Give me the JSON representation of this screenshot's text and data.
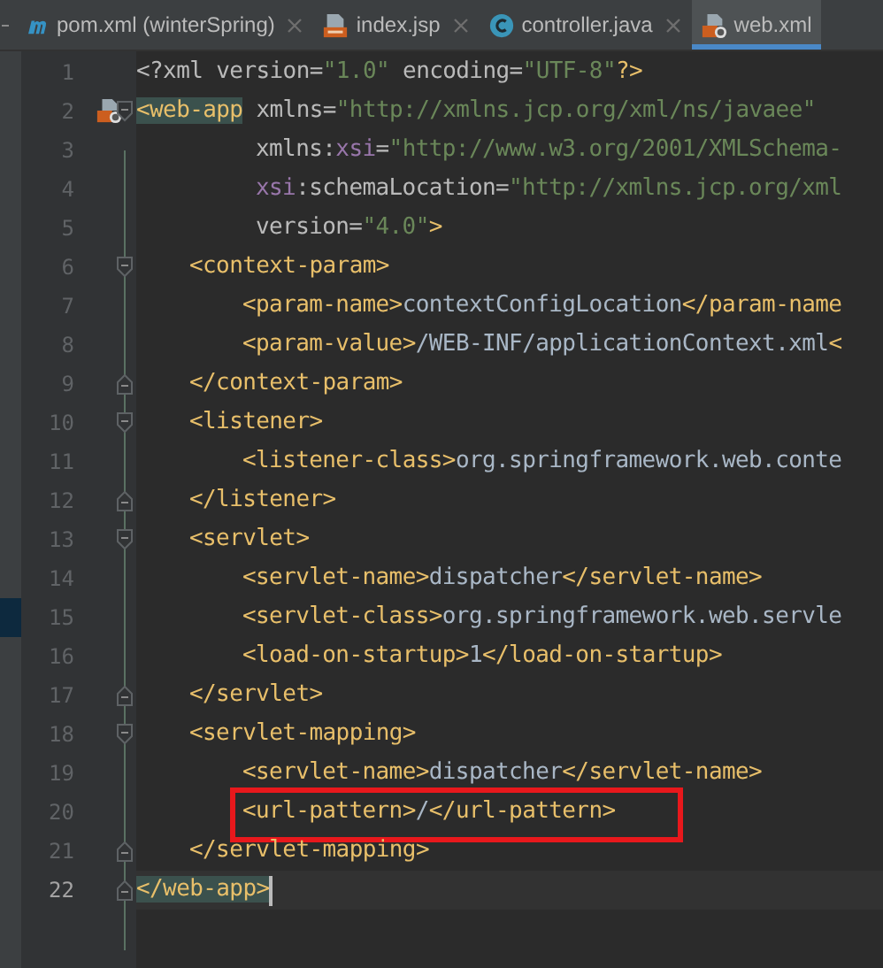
{
  "tabs": [
    {
      "label": "pom.xml (winterSpring)",
      "kind": "maven",
      "selected": false
    },
    {
      "label": "index.jsp",
      "kind": "jsp",
      "selected": false
    },
    {
      "label": "controller.java",
      "kind": "class",
      "selected": false
    },
    {
      "label": "web.xml",
      "kind": "webxml",
      "selected": true
    }
  ],
  "lines": [
    {
      "number": "1",
      "kind": "plain",
      "current": false,
      "boxed": false,
      "side_mark": false,
      "segments": [
        {
          "kind": "attr",
          "text": "<?xml version="
        },
        {
          "kind": "value",
          "text": "\"1.0\""
        },
        {
          "kind": "attr",
          "text": " encoding="
        },
        {
          "kind": "value",
          "text": "\"UTF-8\""
        },
        {
          "kind": "tag",
          "text": "?>"
        }
      ]
    },
    {
      "number": "2",
      "kind": "fold_start",
      "current": false,
      "boxed": false,
      "side_mark": false,
      "gutter_icon": true,
      "segments": [
        {
          "kind": "tag",
          "text": "<web-app",
          "matched": true
        },
        {
          "kind": "attr",
          "text": " xmlns="
        },
        {
          "kind": "value",
          "text": "\"http://xmlns.jcp.org/xml/ns/javaee\""
        }
      ]
    },
    {
      "number": "3",
      "kind": "plain",
      "current": false,
      "boxed": false,
      "side_mark": false,
      "segments": [
        {
          "kind": "attr",
          "text": "         xmlns:"
        },
        {
          "kind": "ns",
          "text": "xsi"
        },
        {
          "kind": "attr",
          "text": "="
        },
        {
          "kind": "value",
          "text": "\"http://www.w3.org/2001/XMLSchema-"
        }
      ]
    },
    {
      "number": "4",
      "kind": "plain",
      "current": false,
      "boxed": false,
      "side_mark": false,
      "segments": [
        {
          "kind": "ns",
          "text": "         xsi"
        },
        {
          "kind": "attr",
          "text": ":schemaLocation="
        },
        {
          "kind": "value",
          "text": "\"http://xmlns.jcp.org/xml"
        }
      ]
    },
    {
      "number": "5",
      "kind": "plain",
      "current": false,
      "boxed": false,
      "side_mark": false,
      "segments": [
        {
          "kind": "attr",
          "text": "         version="
        },
        {
          "kind": "value",
          "text": "\"4.0\""
        },
        {
          "kind": "tag",
          "text": ">"
        }
      ]
    },
    {
      "number": "6",
      "kind": "fold_start",
      "current": false,
      "boxed": false,
      "side_mark": false,
      "segments": [
        {
          "kind": "tag",
          "text": "    <context-param>"
        }
      ]
    },
    {
      "number": "7",
      "kind": "plain",
      "current": false,
      "boxed": false,
      "side_mark": false,
      "segments": [
        {
          "kind": "tag",
          "text": "        <param-name>"
        },
        {
          "kind": "text",
          "text": "contextConfigLocation"
        },
        {
          "kind": "tag",
          "text": "</param-name"
        }
      ]
    },
    {
      "number": "8",
      "kind": "plain",
      "current": false,
      "boxed": false,
      "side_mark": false,
      "segments": [
        {
          "kind": "tag",
          "text": "        <param-value>"
        },
        {
          "kind": "text",
          "text": "/WEB-INF/applicationContext.xml"
        },
        {
          "kind": "tag",
          "text": "<"
        }
      ]
    },
    {
      "number": "9",
      "kind": "fold_end",
      "current": false,
      "boxed": false,
      "side_mark": false,
      "segments": [
        {
          "kind": "tag",
          "text": "    </context-param>"
        }
      ]
    },
    {
      "number": "10",
      "kind": "fold_start",
      "current": false,
      "boxed": false,
      "side_mark": false,
      "segments": [
        {
          "kind": "tag",
          "text": "    <listener>"
        }
      ]
    },
    {
      "number": "11",
      "kind": "plain",
      "current": false,
      "boxed": false,
      "side_mark": false,
      "segments": [
        {
          "kind": "tag",
          "text": "        <listener-class>"
        },
        {
          "kind": "text",
          "text": "org.springframework.web.conte"
        }
      ]
    },
    {
      "number": "12",
      "kind": "fold_end",
      "current": false,
      "boxed": false,
      "side_mark": false,
      "segments": [
        {
          "kind": "tag",
          "text": "    </listener>"
        }
      ]
    },
    {
      "number": "13",
      "kind": "fold_start",
      "current": false,
      "boxed": false,
      "side_mark": false,
      "segments": [
        {
          "kind": "tag",
          "text": "    <servlet>"
        }
      ]
    },
    {
      "number": "14",
      "kind": "plain",
      "current": false,
      "boxed": false,
      "side_mark": false,
      "segments": [
        {
          "kind": "tag",
          "text": "        <servlet-name>"
        },
        {
          "kind": "text",
          "text": "dispatcher"
        },
        {
          "kind": "tag",
          "text": "</servlet-name>"
        }
      ]
    },
    {
      "number": "15",
      "kind": "plain",
      "current": false,
      "boxed": false,
      "side_mark": true,
      "segments": [
        {
          "kind": "tag",
          "text": "        <servlet-class>"
        },
        {
          "kind": "text",
          "text": "org.springframework.web.servle"
        }
      ]
    },
    {
      "number": "16",
      "kind": "plain",
      "current": false,
      "boxed": false,
      "side_mark": false,
      "segments": [
        {
          "kind": "tag",
          "text": "        <load-on-startup>"
        },
        {
          "kind": "text",
          "text": "1"
        },
        {
          "kind": "tag",
          "text": "</load-on-startup>"
        }
      ]
    },
    {
      "number": "17",
      "kind": "fold_end",
      "current": false,
      "boxed": false,
      "side_mark": false,
      "segments": [
        {
          "kind": "tag",
          "text": "    </servlet>"
        }
      ]
    },
    {
      "number": "18",
      "kind": "fold_start",
      "current": false,
      "boxed": false,
      "side_mark": false,
      "segments": [
        {
          "kind": "tag",
          "text": "    <servlet-mapping>"
        }
      ]
    },
    {
      "number": "19",
      "kind": "plain",
      "current": false,
      "boxed": false,
      "side_mark": false,
      "segments": [
        {
          "kind": "tag",
          "text": "        <servlet-name>"
        },
        {
          "kind": "text",
          "text": "dispatcher"
        },
        {
          "kind": "tag",
          "text": "</servlet-name>"
        }
      ]
    },
    {
      "number": "20",
      "kind": "plain",
      "current": false,
      "boxed": true,
      "side_mark": false,
      "segments": [
        {
          "kind": "tag",
          "text": "        <url-pattern>"
        },
        {
          "kind": "text",
          "text": "/"
        },
        {
          "kind": "tag",
          "text": "</url-pattern>"
        }
      ]
    },
    {
      "number": "21",
      "kind": "fold_end",
      "current": false,
      "boxed": false,
      "side_mark": false,
      "segments": [
        {
          "kind": "tag",
          "text": "    </servlet-mapping>"
        }
      ]
    },
    {
      "number": "22",
      "kind": "fold_end",
      "current": true,
      "boxed": false,
      "side_mark": false,
      "segments": [
        {
          "kind": "tag",
          "text": "</web-app>",
          "matched": true
        }
      ]
    }
  ]
}
